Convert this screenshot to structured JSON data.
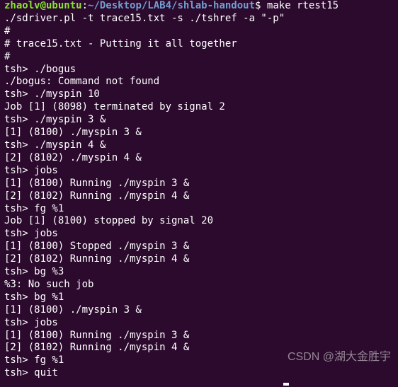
{
  "prompt": {
    "user_host": "zhaolv@ubuntu",
    "path": "~/Desktop/LAB4/shlab-handout",
    "separator": ":",
    "end": "$"
  },
  "cmd_make": "make rtest15",
  "lines": [
    "./sdriver.pl -t trace15.txt -s ./tshref -a \"-p\"",
    "#",
    "# trace15.txt - Putting it all together",
    "#",
    "tsh> ./bogus",
    "./bogus: Command not found",
    "tsh> ./myspin 10",
    "Job [1] (8098) terminated by signal 2",
    "tsh> ./myspin 3 &",
    "[1] (8100) ./myspin 3 &",
    "tsh> ./myspin 4 &",
    "[2] (8102) ./myspin 4 &",
    "tsh> jobs",
    "[1] (8100) Running ./myspin 3 &",
    "[2] (8102) Running ./myspin 4 &",
    "tsh> fg %1",
    "Job [1] (8100) stopped by signal 20",
    "tsh> jobs",
    "[1] (8100) Stopped ./myspin 3 &",
    "[2] (8102) Running ./myspin 4 &",
    "tsh> bg %3",
    "%3: No such job",
    "tsh> bg %1",
    "[1] (8100) ./myspin 3 &",
    "tsh> jobs",
    "[1] (8100) Running ./myspin 3 &",
    "[2] (8102) Running ./myspin 4 &",
    "tsh> fg %1",
    "tsh> quit"
  ],
  "watermark": "CSDN @湖大金胜宇"
}
